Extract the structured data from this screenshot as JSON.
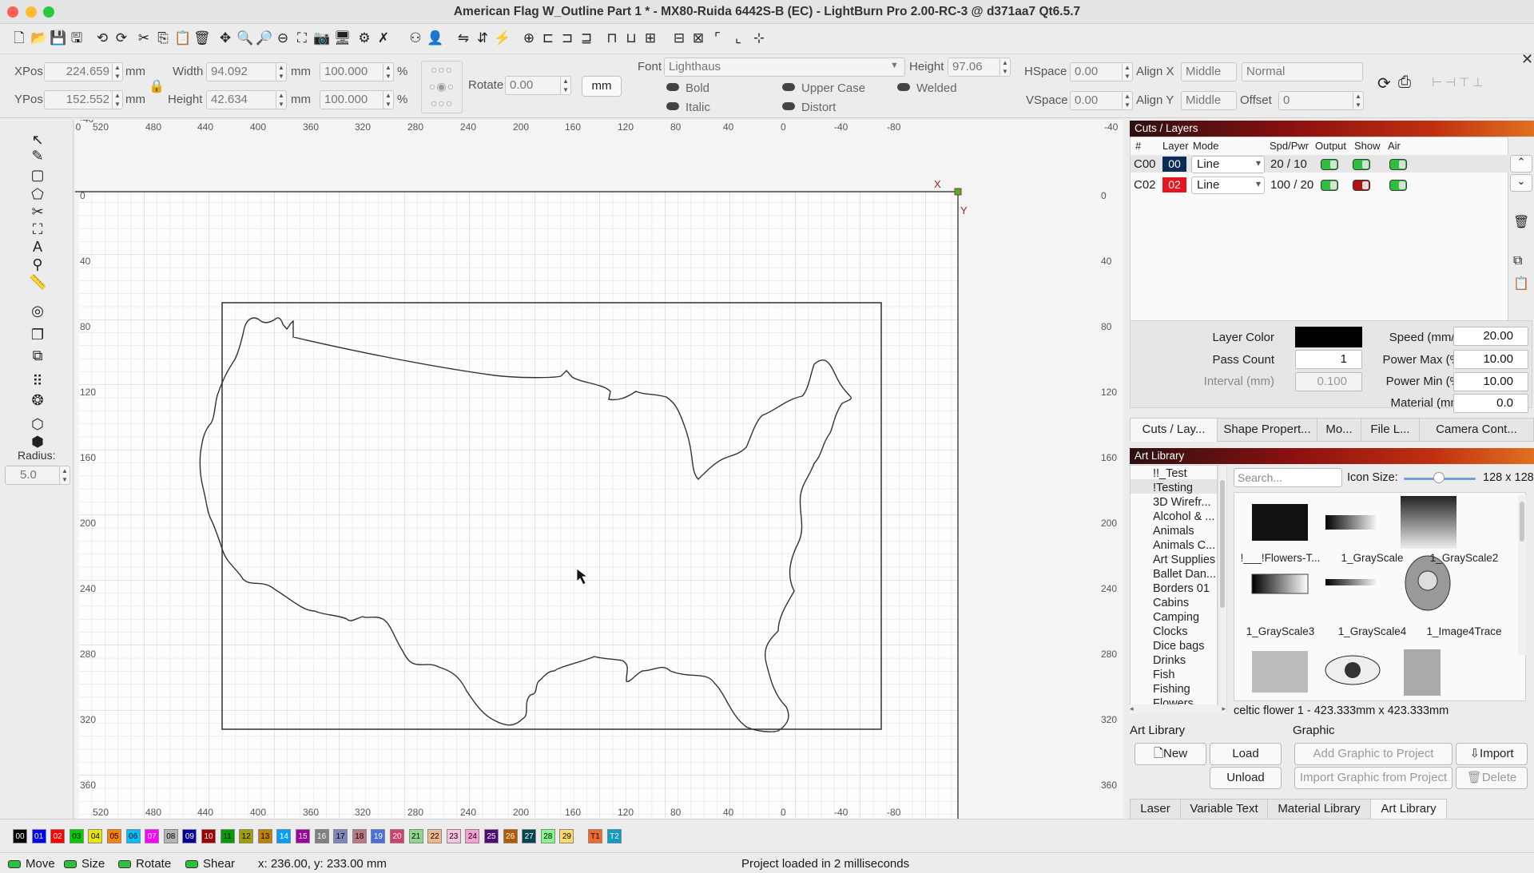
{
  "window": {
    "title": "American Flag W_Outline Part 1 * - MX80-Ruida 6442S-B (EC) - LightBurn Pro 2.00-RC-3 @ d371aa7 Qt6.5.7"
  },
  "toolbar": {
    "icons": [
      "new-file",
      "open-file",
      "save-file",
      "save-as",
      "undo",
      "redo",
      "cut",
      "copy",
      "paste",
      "delete",
      "move",
      "zoom-in",
      "zoom-in-alt",
      "zoom-out",
      "zoom-frame",
      "camera",
      "monitor",
      "settings",
      "tools",
      "group",
      "user",
      "mirror",
      "flip",
      "bolt",
      "target",
      "align-left",
      "align-center",
      "align-right",
      "distribute-h",
      "distribute-v",
      "distribute-gap",
      "center-h",
      "center-v",
      "corner",
      "step-path",
      "measure"
    ]
  },
  "props": {
    "xpos_label": "XPos",
    "xpos": "224.659",
    "ypos_label": "YPos",
    "ypos": "152.552",
    "unit": "mm",
    "width_label": "Width",
    "width": "94.092",
    "height_label": "Height",
    "height": "42.634",
    "scale_w": "100.000",
    "scale_h": "100.000",
    "pct": "%",
    "rotate_label": "Rotate",
    "rotate": "0.00",
    "units_btn": "mm",
    "font_label": "Font",
    "font": "Lighthaus",
    "font_height_label": "Height",
    "font_height": "97.06",
    "hspace_label": "HSpace",
    "hspace": "0.00",
    "vspace_label": "VSpace",
    "vspace": "0.00",
    "alignx_label": "Align X",
    "alignx": "Middle",
    "aligny_label": "Align Y",
    "aligny": "Middle",
    "style": "Normal",
    "offset_label": "Offset",
    "offset": "0",
    "bold": "Bold",
    "italic": "Italic",
    "upper_case": "Upper Case",
    "distort": "Distort",
    "welded": "Welded"
  },
  "left_tools": {
    "radius_label": "Radius:",
    "radius": "5.0"
  },
  "rulers": {
    "top": [
      "-40",
      "520",
      "480",
      "440",
      "400",
      "360",
      "320",
      "280",
      "240",
      "200",
      "160",
      "120",
      "80",
      "40",
      "0",
      "-40",
      "-80",
      "-40"
    ],
    "left": [
      "-40",
      "0",
      "40",
      "80",
      "120",
      "160",
      "200",
      "240",
      "280",
      "320",
      "360"
    ],
    "right": [
      "0",
      "40",
      "80",
      "120",
      "160",
      "200",
      "240",
      "280",
      "320",
      "360"
    ],
    "axis_x": "X",
    "axis_y": "Y"
  },
  "cuts": {
    "header": "Cuts / Layers",
    "cols": [
      "#",
      "Layer",
      "Mode",
      "Spd/Pwr",
      "Output",
      "Show",
      "Air"
    ],
    "rows": [
      {
        "id": "C00",
        "layer": "00",
        "color": "#0a2c56",
        "mode": "Line",
        "spdpwr": "20 / 10",
        "show": "on"
      },
      {
        "id": "C02",
        "layer": "02",
        "color": "#e8141e",
        "mode": "Line",
        "spdpwr": "100 / 20",
        "show": "red"
      }
    ],
    "layer_color_label": "Layer Color",
    "pass_count_label": "Pass Count",
    "pass_count": "1",
    "interval_label": "Interval (mm)",
    "interval": "0.100",
    "speed_label": "Speed (mm/s)",
    "speed": "20.00",
    "power_max_label": "Power Max (%)",
    "power_max": "10.00",
    "power_min_label": "Power Min (%)",
    "power_min": "10.00",
    "material_label": "Material (mm)",
    "material": "0.0",
    "tabs": [
      "Cuts / Lay...",
      "Shape Propert...",
      "Mo...",
      "File L...",
      "Camera Cont..."
    ]
  },
  "art": {
    "header": "Art Library",
    "categories": [
      "!!_Test",
      "!Testing",
      "3D Wirefr...",
      "Alcohol & ...",
      "Animals",
      "Animals C...",
      "Art Supplies",
      "Ballet Dan...",
      "Borders 01",
      "Cabins",
      "Camping",
      "Clocks",
      "Dice bags",
      "Drinks",
      "Fish",
      "Fishing",
      "Flowers"
    ],
    "search_placeholder": "Search...",
    "icon_size_label": "Icon Size:",
    "icon_size": "128 x 128",
    "thumbs": [
      "!___!Flowers-T...",
      "1_GrayScale",
      "1_GrayScale2",
      "1_GrayScale3",
      "1_GrayScale4",
      "1_Image4Trace",
      "",
      "",
      ""
    ],
    "info": "celtic flower 1 - 423.333mm x 423.333mm",
    "lib_label": "Art Library",
    "graphic_label": "Graphic",
    "btn_new": "New",
    "btn_load": "Load",
    "btn_unload": "Unload",
    "btn_add": "Add Graphic to Project",
    "btn_import": "Import",
    "btn_import_from": "Import Graphic from Project",
    "btn_delete": "Delete",
    "bottom_tabs": [
      "Laser",
      "Variable Text",
      "Material Library",
      "Art Library"
    ]
  },
  "palette": [
    {
      "l": "00",
      "c": "#000000",
      "t": "#fff"
    },
    {
      "l": "01",
      "c": "#0000ff",
      "t": "#fff"
    },
    {
      "l": "02",
      "c": "#ff0000",
      "t": "#fff"
    },
    {
      "l": "03",
      "c": "#00cc00",
      "t": "#000"
    },
    {
      "l": "04",
      "c": "#e8e800",
      "t": "#000"
    },
    {
      "l": "05",
      "c": "#ff8000",
      "t": "#000"
    },
    {
      "l": "06",
      "c": "#00c0ff",
      "t": "#000"
    },
    {
      "l": "07",
      "c": "#ff00ff",
      "t": "#fff"
    },
    {
      "l": "08",
      "c": "#b4b4b4",
      "t": "#000"
    },
    {
      "l": "09",
      "c": "#0000a0",
      "t": "#fff"
    },
    {
      "l": "10",
      "c": "#a00000",
      "t": "#fff"
    },
    {
      "l": "11",
      "c": "#00a000",
      "t": "#000"
    },
    {
      "l": "12",
      "c": "#a0a000",
      "t": "#000"
    },
    {
      "l": "13",
      "c": "#c08000",
      "t": "#000"
    },
    {
      "l": "14",
      "c": "#00a0ff",
      "t": "#fff"
    },
    {
      "l": "15",
      "c": "#a000a0",
      "t": "#fff"
    },
    {
      "l": "16",
      "c": "#808080",
      "t": "#fff"
    },
    {
      "l": "17",
      "c": "#7d87b9",
      "t": "#000"
    },
    {
      "l": "18",
      "c": "#bb7784",
      "t": "#000"
    },
    {
      "l": "19",
      "c": "#4a6fe3",
      "t": "#fff"
    },
    {
      "l": "20",
      "c": "#d33f6a",
      "t": "#fff"
    },
    {
      "l": "21",
      "c": "#8cd78c",
      "t": "#000"
    },
    {
      "l": "22",
      "c": "#f0b98d",
      "t": "#000"
    },
    {
      "l": "23",
      "c": "#f6c4e1",
      "t": "#000"
    },
    {
      "l": "24",
      "c": "#fa9ed4",
      "t": "#000"
    },
    {
      "l": "25",
      "c": "#500a78",
      "t": "#fff"
    },
    {
      "l": "26",
      "c": "#b45a00",
      "t": "#fff"
    },
    {
      "l": "27",
      "c": "#004754",
      "t": "#fff"
    },
    {
      "l": "28",
      "c": "#86fa88",
      "t": "#000"
    },
    {
      "l": "29",
      "c": "#ffdb66",
      "t": "#000"
    },
    {
      "l": "T1",
      "c": "#f36926",
      "t": "#000"
    },
    {
      "l": "T2",
      "c": "#0c9ccc",
      "t": "#fff"
    }
  ],
  "status": {
    "move": "Move",
    "size": "Size",
    "rotate": "Rotate",
    "shear": "Shear",
    "coords": "x: 236.00, y: 233.00 mm",
    "message": "Project loaded in 2 milliseconds"
  }
}
